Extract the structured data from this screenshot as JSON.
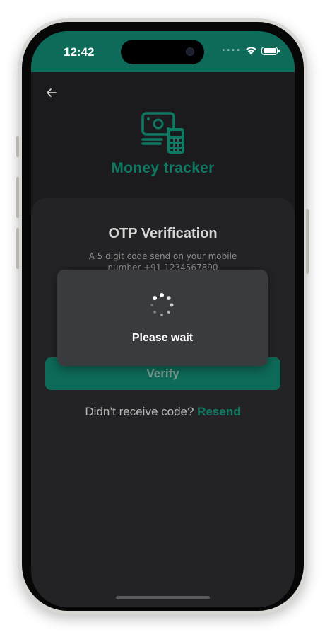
{
  "status_bar": {
    "time": "12:42",
    "dots": "••••"
  },
  "app": {
    "name": "Money tracker"
  },
  "otp": {
    "title": "OTP Verification",
    "subtitle": "A 5 digit code send on your mobile number +91 1234567890"
  },
  "dialog": {
    "message": "Please wait"
  },
  "actions": {
    "verify_label": "Verify",
    "resend_prompt": "Didn’t receive code?",
    "resend_label": "Resend"
  },
  "colors": {
    "accent": "#0e6b59",
    "background": "#1b1b1d",
    "card": "#232326",
    "dialog": "#3a3b3f"
  }
}
